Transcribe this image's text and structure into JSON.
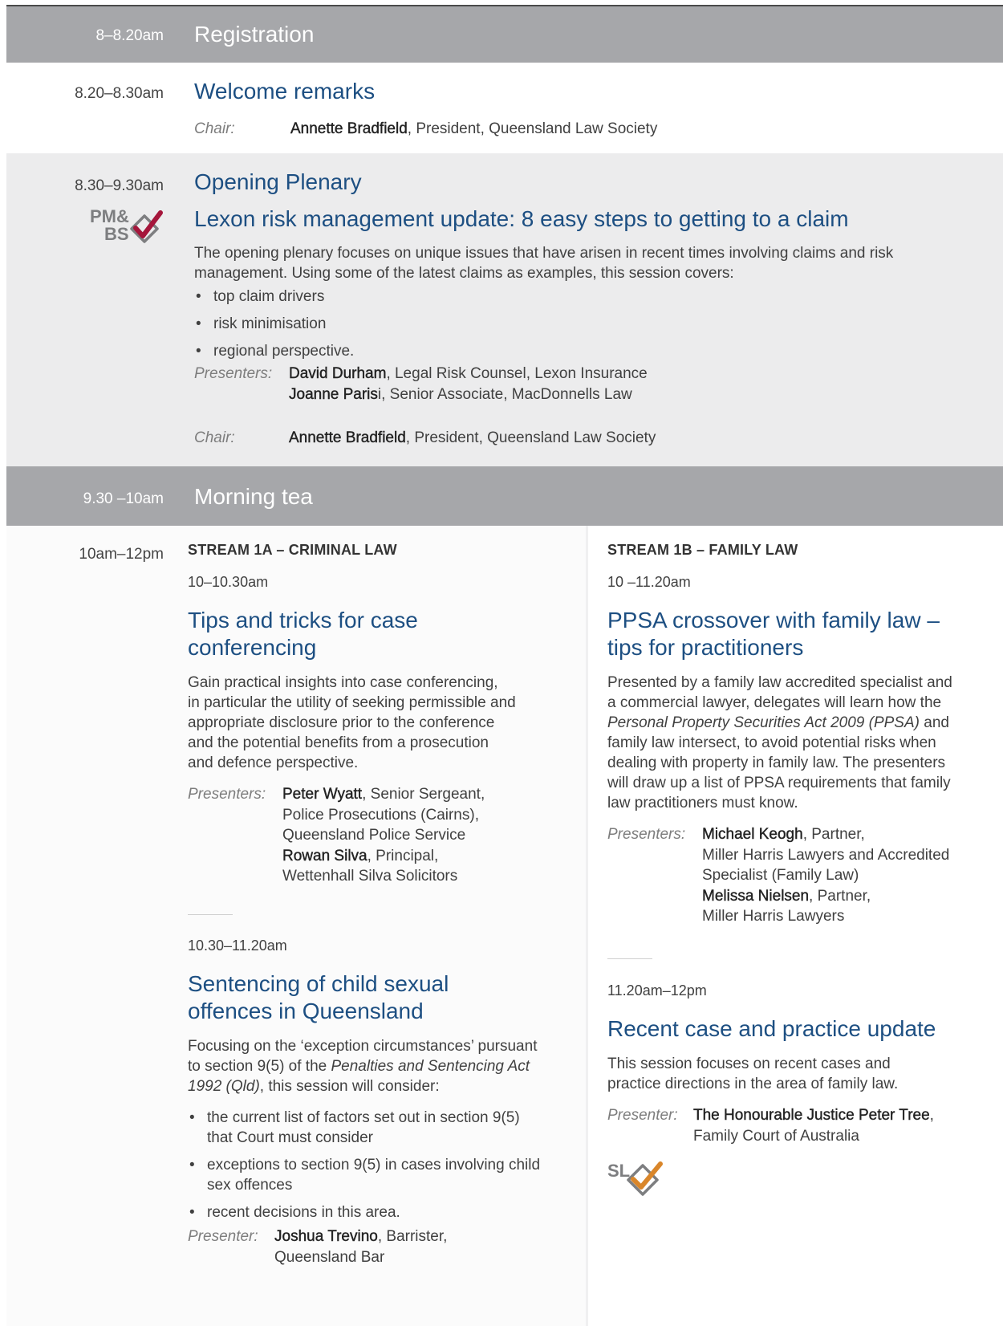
{
  "registration": {
    "time": "8–8.20am",
    "title": "Registration"
  },
  "welcome": {
    "time": "8.20–8.30am",
    "title": "Welcome remarks",
    "chair_label": "Chair:",
    "chair_name": "Annette Bradfield",
    "chair_role": ", President, Queensland Law Society"
  },
  "plenary": {
    "time": "8.30–9.30am",
    "title": "Opening Plenary",
    "badge_line1": "PM&",
    "badge_line2": "BS",
    "subtitle": "Lexon risk management update: 8 easy steps to getting to a claim",
    "intro": "The opening plenary focuses on unique issues that have arisen in recent times involving claims and risk management. Using some of the latest claims as examples, this session covers:",
    "bullets": [
      "top claim drivers",
      "risk minimisation",
      "regional perspective."
    ],
    "presenters_label": "Presenters:",
    "presenters": [
      {
        "name": "David Durham",
        "role": ", Legal Risk Counsel, Lexon Insurance"
      },
      {
        "name": "Joanne Paris",
        "role": "i, Senior Associate, MacDonnells Law"
      }
    ],
    "chair_label": "Chair:",
    "chair_name": "Annette Bradfield",
    "chair_role": ", President, Queensland Law Society"
  },
  "morning_tea": {
    "time": "9.30 –10am",
    "title": "Morning tea"
  },
  "streams": {
    "time": "10am–12pm",
    "a": {
      "heading": "STREAM 1A – CRIMINAL LAW",
      "s1": {
        "time": "10–10.30am",
        "title_line1": "Tips and tricks for case",
        "title_line2": "conferencing",
        "body": [
          "Gain practical insights into case conferencing,",
          "in particular the utility of seeking permissible and",
          "appropriate disclosure prior to the conference",
          "and the potential benefits from a prosecution",
          "and defence perspective."
        ],
        "presenters_label": "Presenters:",
        "p1_name": "Peter Wyatt",
        "p1_role": ", Senior Sergeant,",
        "p1_line2": "Police Prosecutions (Cairns),",
        "p1_line3": "Queensland Police Service",
        "p2_name": "Rowan Silva",
        "p2_role": ", Principal,",
        "p2_line2": "Wettenhall Silva Solicitors"
      },
      "s2": {
        "time": "10.30–11.20am",
        "title_line1": "Sentencing of child sexual",
        "title_line2": "offences in Queensland",
        "body_line1": "Focusing on the ‘exception circumstances’ pursuant",
        "body_line2_a": "to section 9(5) of the ",
        "body_line2_i": "Penalties and Sentencing Act",
        "body_line3_i": "1992 (Qld)",
        "body_line3_b": ", this session will consider:",
        "bullets": [
          [
            "the current list of factors set out in section 9(5)",
            "that Court must consider"
          ],
          [
            "exceptions to section 9(5) in cases involving child",
            "sex offences"
          ],
          [
            "recent decisions in this area.",
            ""
          ]
        ],
        "presenter_label": "Presenter:",
        "p1_name": "Joshua Trevino",
        "p1_role": ", Barrister,",
        "p1_line2": "Queensland Bar"
      }
    },
    "b": {
      "heading": "STREAM 1B – FAMILY LAW",
      "s1": {
        "time": "10 –11.20am",
        "title_line1": "PPSA crossover with family law –",
        "title_line2": "tips for practitioners",
        "body_line1": "Presented by a family law accredited specialist and",
        "body_line2": "a commercial lawyer, delegates will learn how the",
        "body_line3_i": "Personal Property Securities Act 2009 (PPSA)",
        "body_line3_b": " and",
        "body_rest": [
          "family law intersect, to avoid potential risks when",
          "dealing with property in family law. The presenters",
          "will draw up a list of PPSA requirements that family",
          "law practitioners must know."
        ],
        "presenters_label": "Presenters:",
        "p1_name": "Michael Keogh",
        "p1_role": ", Partner,",
        "p1_line2": "Miller Harris Lawyers and Accredited",
        "p1_line3": "Specialist (Family Law)",
        "p2_name": "Melissa Nielsen",
        "p2_role": ", Partner,",
        "p2_line2": "Miller Harris Lawyers"
      },
      "s2": {
        "time": "11.20am–12pm",
        "title": "Recent case and practice update",
        "body": [
          "This session focuses on recent cases and",
          "practice directions in the area of family law."
        ],
        "presenter_label": "Presenter:",
        "p1_name": "The Honourable Justice Peter Tree",
        "p1_role": ",",
        "p1_line2": "Family Court of Australia",
        "badge": "SL"
      }
    }
  },
  "colors": {
    "dark_band": "#a6a7aa",
    "light_band": "#ececed",
    "title_blue": "#1d4f82",
    "check_red": "#a5163b",
    "check_orange": "#d9862a",
    "badge_grey": "#7d7e80"
  }
}
